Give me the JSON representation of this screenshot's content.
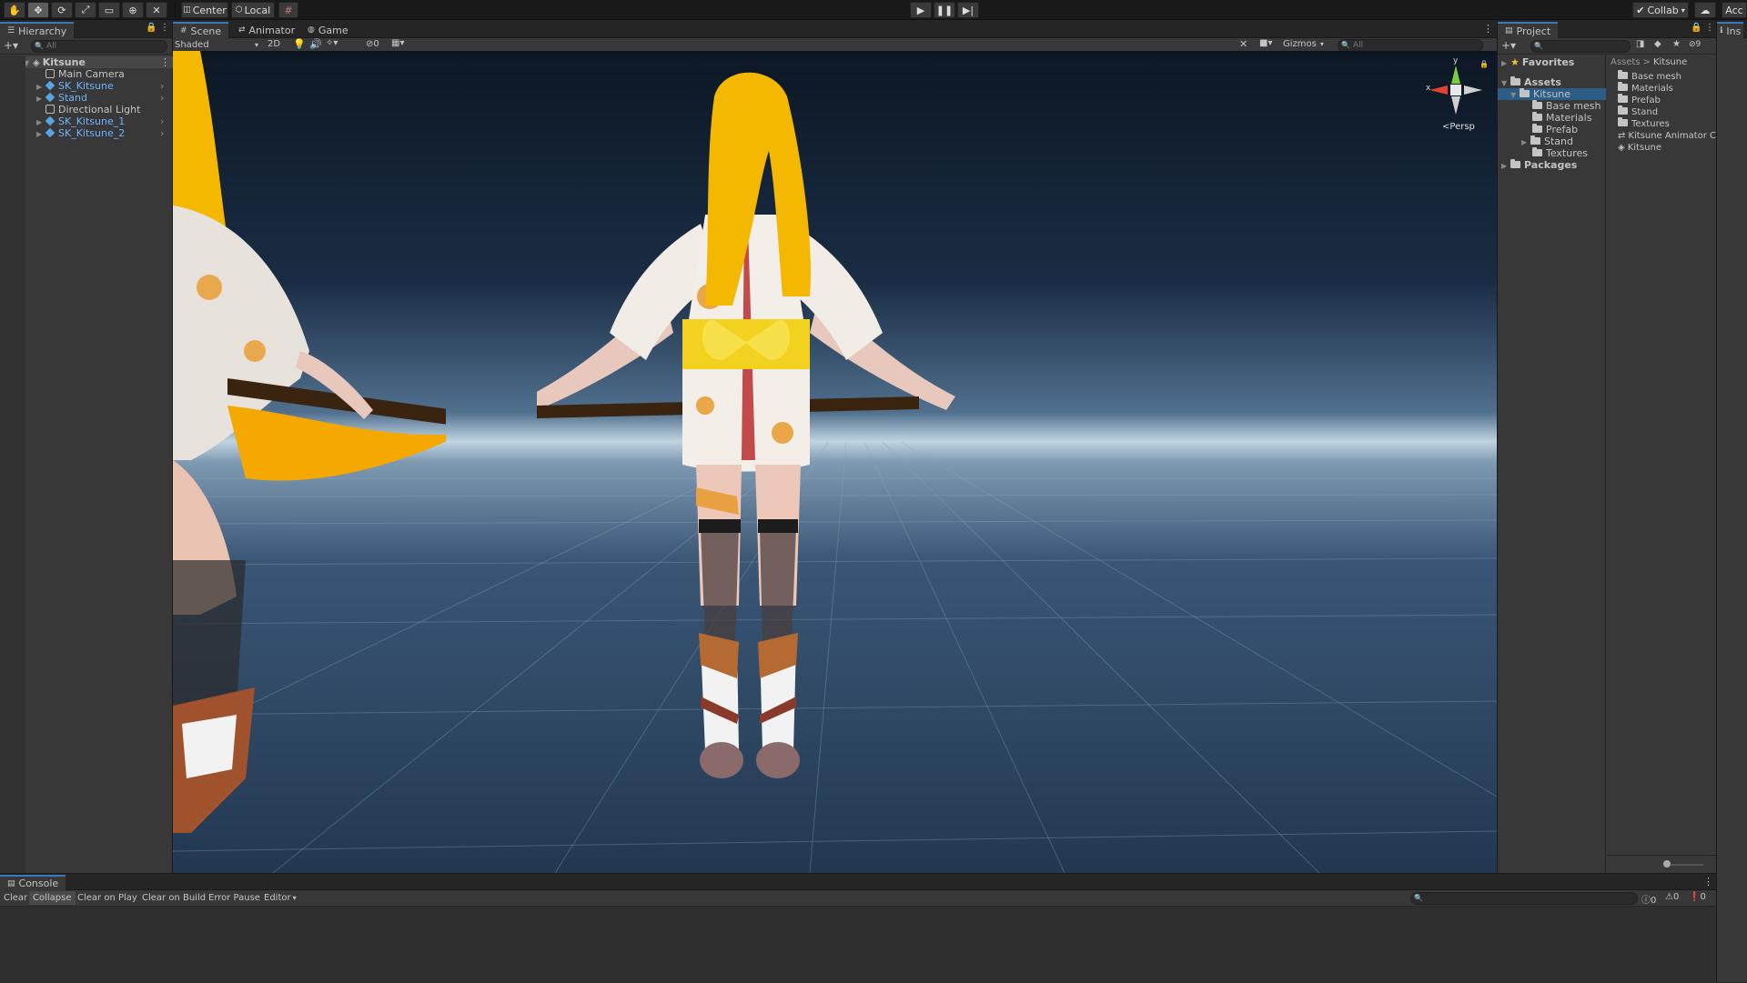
{
  "toolbar": {
    "tools": [
      "hand-icon",
      "move-icon",
      "rotate-icon",
      "scale-icon",
      "rect-icon",
      "transform-icon",
      "custom-icon"
    ],
    "pivot_label": "Center",
    "space_label": "Local",
    "collab_label": "Collab",
    "account_label": "Acc",
    "play_icons": [
      "play-icon",
      "pause-icon",
      "step-icon"
    ]
  },
  "hierarchy": {
    "tab_label": "Hierarchy",
    "search_placeholder": "All",
    "scene_name": "Kitsune",
    "items": [
      {
        "label": "Main Camera",
        "prefab": false
      },
      {
        "label": "SK_Kitsune",
        "prefab": true
      },
      {
        "label": "Stand",
        "prefab": true
      },
      {
        "label": "Directional Light",
        "prefab": false
      },
      {
        "label": "SK_Kitsune_1",
        "prefab": true
      },
      {
        "label": "SK_Kitsune_2",
        "prefab": true
      }
    ]
  },
  "scene": {
    "tabs": [
      "Scene",
      "Animator",
      "Game"
    ],
    "active_tab": "Scene",
    "shading_mode": "Shaded",
    "mode_2d": "2D",
    "hidden_count": "0",
    "gizmos_label": "Gizmos",
    "search_placeholder": "All",
    "projection_label": "Persp",
    "axis_y": "y",
    "axis_x": "x"
  },
  "project": {
    "tab_label": "Project",
    "favorites_label": "Favorites",
    "assets_label": "Assets",
    "tree_folder": "Kitsune",
    "tree_children": [
      "Base mesh",
      "Materials",
      "Prefab",
      "Stand",
      "Textures"
    ],
    "packages_label": "Packages",
    "breadcrumb": [
      "Assets",
      "Kitsune"
    ],
    "contents": [
      {
        "label": "Base mesh",
        "kind": "folder"
      },
      {
        "label": "Materials",
        "kind": "folder"
      },
      {
        "label": "Prefab",
        "kind": "folder"
      },
      {
        "label": "Stand",
        "kind": "folder"
      },
      {
        "label": "Textures",
        "kind": "folder"
      },
      {
        "label": "Kitsune Animator Co",
        "kind": "animator"
      },
      {
        "label": "Kitsune",
        "kind": "prefab"
      }
    ],
    "hidden_count": "9"
  },
  "inspector": {
    "tab_label": "Ins"
  },
  "console": {
    "tab_label": "Console",
    "buttons": [
      "Clear",
      "Collapse",
      "Clear on Play",
      "Clear on Build",
      "Error Pause",
      "Editor"
    ],
    "log_count": "0",
    "warn_count": "0",
    "error_count": "0"
  },
  "colors": {
    "hair": "#f5b800",
    "obi": "#f2d21e",
    "selection_blue": "#3a79bb",
    "prefab_blue": "#6cb4ff"
  }
}
